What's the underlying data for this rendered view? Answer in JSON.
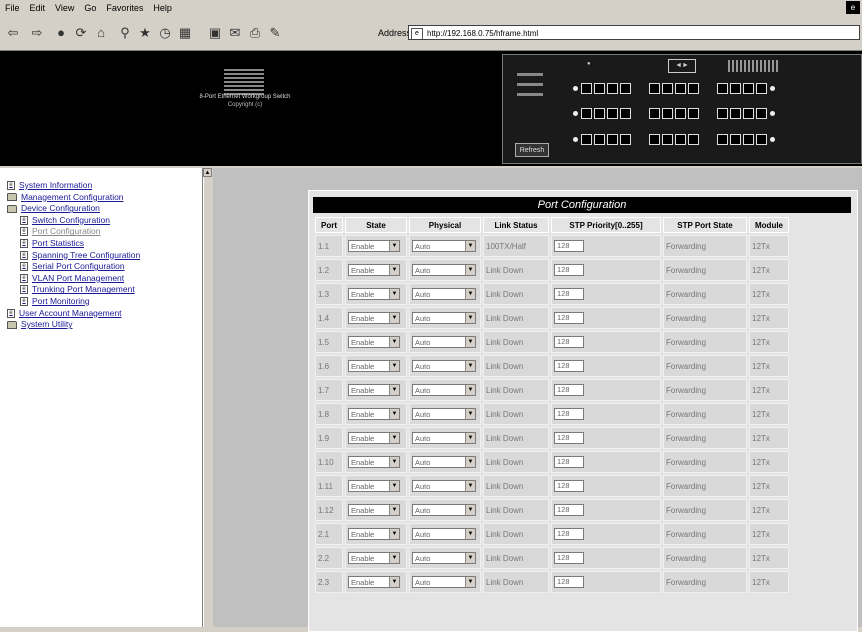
{
  "menu": [
    "File",
    "Edit",
    "View",
    "Go",
    "Favorites",
    "Help"
  ],
  "toolbar": {
    "buttons": [
      {
        "icon": "back-arrow-icon",
        "glyph": "⇦"
      },
      {
        "icon": "forward-arrow-icon",
        "glyph": "⇨"
      },
      {
        "icon": "stop-icon",
        "glyph": "●"
      },
      {
        "icon": "refresh-icon",
        "glyph": "⟳"
      },
      {
        "icon": "home-icon",
        "glyph": "⌂"
      },
      {
        "icon": "search-icon",
        "glyph": "⚲"
      },
      {
        "icon": "favorites-icon",
        "glyph": "★"
      },
      {
        "icon": "history-icon",
        "glyph": "◷"
      },
      {
        "icon": "channels-icon",
        "glyph": "▦"
      },
      {
        "icon": "fullscreen-icon",
        "glyph": "▣"
      },
      {
        "icon": "mail-icon",
        "glyph": "✉"
      },
      {
        "icon": "print-icon",
        "glyph": "⎙"
      },
      {
        "icon": "edit-icon",
        "glyph": "✎"
      }
    ],
    "address_label": "Address",
    "address_value": "http://192.168.0.75/hframe.html"
  },
  "header": {
    "product_name": "8-Port Ethernet Workgroup Switch",
    "copyright": "Copyright (c)",
    "refresh_label": "Refresh"
  },
  "nav": [
    {
      "label": "System Information",
      "icon": "page",
      "indent": 0,
      "current": false
    },
    {
      "label": "Management Configuration",
      "icon": "folder",
      "indent": 0,
      "current": false
    },
    {
      "label": "Device Configuration",
      "icon": "folder-open",
      "indent": 0,
      "current": false
    },
    {
      "label": "Switch Configuration",
      "icon": "page",
      "indent": 1,
      "current": false
    },
    {
      "label": "Port Configuration",
      "icon": "page",
      "indent": 1,
      "current": true
    },
    {
      "label": "Port Statistics",
      "icon": "page",
      "indent": 1,
      "current": false
    },
    {
      "label": "Spanning Tree Configuration",
      "icon": "page",
      "indent": 1,
      "current": false
    },
    {
      "label": "Serial Port Configuration",
      "icon": "page",
      "indent": 1,
      "current": false
    },
    {
      "label": "VLAN Port Management",
      "icon": "page",
      "indent": 1,
      "current": false
    },
    {
      "label": "Trunking Port Management",
      "icon": "page",
      "indent": 1,
      "current": false
    },
    {
      "label": "Port Monitoring",
      "icon": "page",
      "indent": 1,
      "current": false
    },
    {
      "label": "User Account Management",
      "icon": "page",
      "indent": 0,
      "current": false
    },
    {
      "label": "System Utility",
      "icon": "folder",
      "indent": 0,
      "current": false
    }
  ],
  "table": {
    "title": "Port Configuration",
    "headers": [
      "Port",
      "State",
      "Physical",
      "Link Status",
      "STP Priority[0..255]",
      "STP Port State",
      "Module"
    ],
    "rows": [
      {
        "port": "1.1",
        "state": "Enable",
        "physical": "Auto",
        "link": "100TX/Half",
        "priority": "128",
        "stp_state": "Forwarding",
        "module": "12Tx"
      },
      {
        "port": "1.2",
        "state": "Enable",
        "physical": "Auto",
        "link": "Link Down",
        "priority": "128",
        "stp_state": "Forwarding",
        "module": "12Tx"
      },
      {
        "port": "1.3",
        "state": "Enable",
        "physical": "Auto",
        "link": "Link Down",
        "priority": "128",
        "stp_state": "Forwarding",
        "module": "12Tx"
      },
      {
        "port": "1.4",
        "state": "Enable",
        "physical": "Auto",
        "link": "Link Down",
        "priority": "128",
        "stp_state": "Forwarding",
        "module": "12Tx"
      },
      {
        "port": "1.5",
        "state": "Enable",
        "physical": "Auto",
        "link": "Link Down",
        "priority": "128",
        "stp_state": "Forwarding",
        "module": "12Tx"
      },
      {
        "port": "1.6",
        "state": "Enable",
        "physical": "Auto",
        "link": "Link Down",
        "priority": "128",
        "stp_state": "Forwarding",
        "module": "12Tx"
      },
      {
        "port": "1.7",
        "state": "Enable",
        "physical": "Auto",
        "link": "Link Down",
        "priority": "128",
        "stp_state": "Forwarding",
        "module": "12Tx"
      },
      {
        "port": "1.8",
        "state": "Enable",
        "physical": "Auto",
        "link": "Link Down",
        "priority": "128",
        "stp_state": "Forwarding",
        "module": "12Tx"
      },
      {
        "port": "1.9",
        "state": "Enable",
        "physical": "Auto",
        "link": "Link Down",
        "priority": "128",
        "stp_state": "Forwarding",
        "module": "12Tx"
      },
      {
        "port": "1.10",
        "state": "Enable",
        "physical": "Auto",
        "link": "Link Down",
        "priority": "128",
        "stp_state": "Forwarding",
        "module": "12Tx"
      },
      {
        "port": "1.11",
        "state": "Enable",
        "physical": "Auto",
        "link": "Link Down",
        "priority": "128",
        "stp_state": "Forwarding",
        "module": "12Tx"
      },
      {
        "port": "1.12",
        "state": "Enable",
        "physical": "Auto",
        "link": "Link Down",
        "priority": "128",
        "stp_state": "Forwarding",
        "module": "12Tx"
      },
      {
        "port": "2.1",
        "state": "Enable",
        "physical": "Auto",
        "link": "Link Down",
        "priority": "128",
        "stp_state": "Forwarding",
        "module": "12Tx"
      },
      {
        "port": "2.2",
        "state": "Enable",
        "physical": "Auto",
        "link": "Link Down",
        "priority": "128",
        "stp_state": "Forwarding",
        "module": "12Tx"
      },
      {
        "port": "2.3",
        "state": "Enable",
        "physical": "Auto",
        "link": "Link Down",
        "priority": "128",
        "stp_state": "Forwarding",
        "module": "12Tx"
      }
    ]
  }
}
